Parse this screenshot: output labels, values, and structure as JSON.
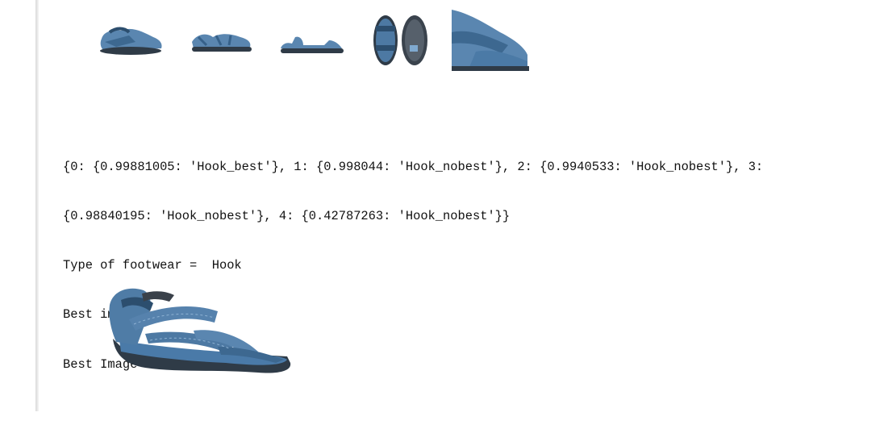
{
  "output": {
    "prediction_dict_line1": "{0: {0.99881005: 'Hook_best'}, 1: {0.998044: 'Hook_nobest'}, 2: {0.9940533: 'Hook_nobest'}, 3:",
    "prediction_dict_line2": "{0.98840195: 'Hook_nobest'}, 4: {0.42787263: 'Hook_nobest'}}",
    "type_line": "Type of footwear =  Hook",
    "best_index_line": "Best image = 1",
    "best_image_line": "Best Image =="
  },
  "colors": {
    "sandal_blue": "#4d79a3",
    "sandal_dark": "#2f3b47",
    "text": "#111111"
  }
}
